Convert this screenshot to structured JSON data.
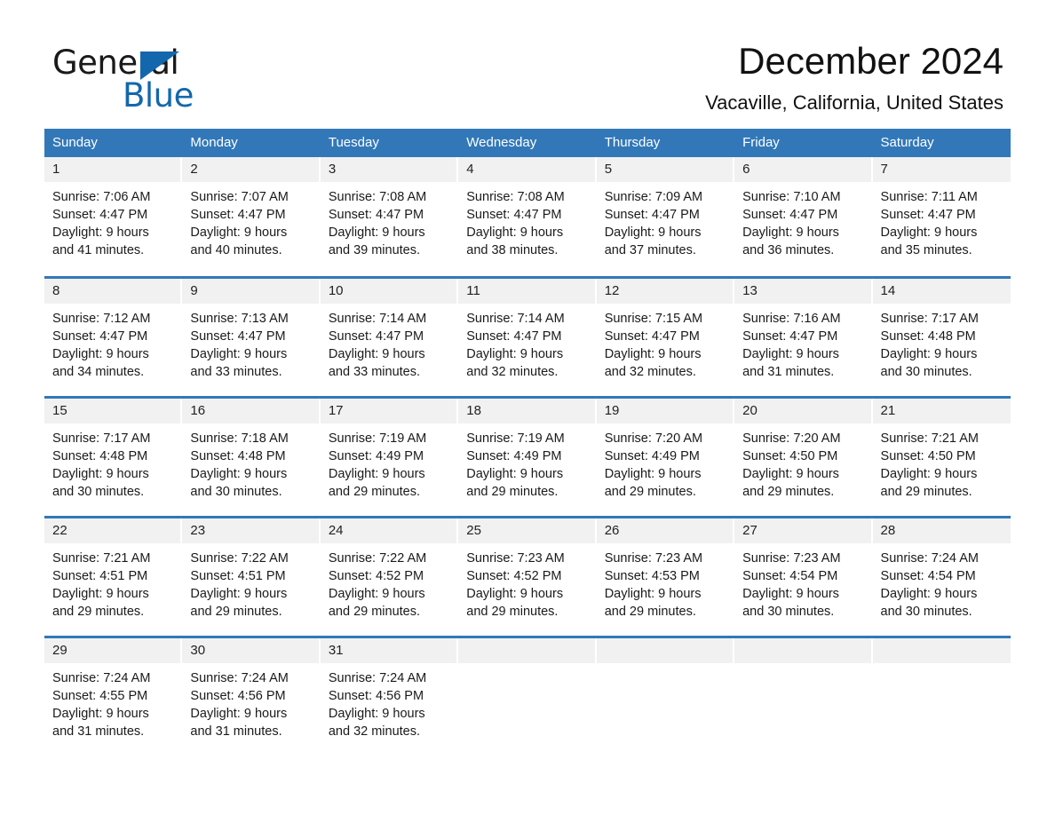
{
  "brand": {
    "name_top": "General",
    "name_bottom": "Blue",
    "triangle_color": "#1368ad",
    "text_color": "#1a1a1a"
  },
  "header": {
    "month_title": "December 2024",
    "location": "Vacaville, California, United States",
    "header_bg": "#3278b8",
    "header_text": "#ffffff",
    "daynum_bg": "#f1f1f1"
  },
  "weekday_headers": [
    "Sunday",
    "Monday",
    "Tuesday",
    "Wednesday",
    "Thursday",
    "Friday",
    "Saturday"
  ],
  "weeks": [
    [
      {
        "day": "1",
        "sunrise": "Sunrise: 7:06 AM",
        "sunset": "Sunset: 4:47 PM",
        "daylight_line1": "Daylight: 9 hours",
        "daylight_line2": "and 41 minutes."
      },
      {
        "day": "2",
        "sunrise": "Sunrise: 7:07 AM",
        "sunset": "Sunset: 4:47 PM",
        "daylight_line1": "Daylight: 9 hours",
        "daylight_line2": "and 40 minutes."
      },
      {
        "day": "3",
        "sunrise": "Sunrise: 7:08 AM",
        "sunset": "Sunset: 4:47 PM",
        "daylight_line1": "Daylight: 9 hours",
        "daylight_line2": "and 39 minutes."
      },
      {
        "day": "4",
        "sunrise": "Sunrise: 7:08 AM",
        "sunset": "Sunset: 4:47 PM",
        "daylight_line1": "Daylight: 9 hours",
        "daylight_line2": "and 38 minutes."
      },
      {
        "day": "5",
        "sunrise": "Sunrise: 7:09 AM",
        "sunset": "Sunset: 4:47 PM",
        "daylight_line1": "Daylight: 9 hours",
        "daylight_line2": "and 37 minutes."
      },
      {
        "day": "6",
        "sunrise": "Sunrise: 7:10 AM",
        "sunset": "Sunset: 4:47 PM",
        "daylight_line1": "Daylight: 9 hours",
        "daylight_line2": "and 36 minutes."
      },
      {
        "day": "7",
        "sunrise": "Sunrise: 7:11 AM",
        "sunset": "Sunset: 4:47 PM",
        "daylight_line1": "Daylight: 9 hours",
        "daylight_line2": "and 35 minutes."
      }
    ],
    [
      {
        "day": "8",
        "sunrise": "Sunrise: 7:12 AM",
        "sunset": "Sunset: 4:47 PM",
        "daylight_line1": "Daylight: 9 hours",
        "daylight_line2": "and 34 minutes."
      },
      {
        "day": "9",
        "sunrise": "Sunrise: 7:13 AM",
        "sunset": "Sunset: 4:47 PM",
        "daylight_line1": "Daylight: 9 hours",
        "daylight_line2": "and 33 minutes."
      },
      {
        "day": "10",
        "sunrise": "Sunrise: 7:14 AM",
        "sunset": "Sunset: 4:47 PM",
        "daylight_line1": "Daylight: 9 hours",
        "daylight_line2": "and 33 minutes."
      },
      {
        "day": "11",
        "sunrise": "Sunrise: 7:14 AM",
        "sunset": "Sunset: 4:47 PM",
        "daylight_line1": "Daylight: 9 hours",
        "daylight_line2": "and 32 minutes."
      },
      {
        "day": "12",
        "sunrise": "Sunrise: 7:15 AM",
        "sunset": "Sunset: 4:47 PM",
        "daylight_line1": "Daylight: 9 hours",
        "daylight_line2": "and 32 minutes."
      },
      {
        "day": "13",
        "sunrise": "Sunrise: 7:16 AM",
        "sunset": "Sunset: 4:47 PM",
        "daylight_line1": "Daylight: 9 hours",
        "daylight_line2": "and 31 minutes."
      },
      {
        "day": "14",
        "sunrise": "Sunrise: 7:17 AM",
        "sunset": "Sunset: 4:48 PM",
        "daylight_line1": "Daylight: 9 hours",
        "daylight_line2": "and 30 minutes."
      }
    ],
    [
      {
        "day": "15",
        "sunrise": "Sunrise: 7:17 AM",
        "sunset": "Sunset: 4:48 PM",
        "daylight_line1": "Daylight: 9 hours",
        "daylight_line2": "and 30 minutes."
      },
      {
        "day": "16",
        "sunrise": "Sunrise: 7:18 AM",
        "sunset": "Sunset: 4:48 PM",
        "daylight_line1": "Daylight: 9 hours",
        "daylight_line2": "and 30 minutes."
      },
      {
        "day": "17",
        "sunrise": "Sunrise: 7:19 AM",
        "sunset": "Sunset: 4:49 PM",
        "daylight_line1": "Daylight: 9 hours",
        "daylight_line2": "and 29 minutes."
      },
      {
        "day": "18",
        "sunrise": "Sunrise: 7:19 AM",
        "sunset": "Sunset: 4:49 PM",
        "daylight_line1": "Daylight: 9 hours",
        "daylight_line2": "and 29 minutes."
      },
      {
        "day": "19",
        "sunrise": "Sunrise: 7:20 AM",
        "sunset": "Sunset: 4:49 PM",
        "daylight_line1": "Daylight: 9 hours",
        "daylight_line2": "and 29 minutes."
      },
      {
        "day": "20",
        "sunrise": "Sunrise: 7:20 AM",
        "sunset": "Sunset: 4:50 PM",
        "daylight_line1": "Daylight: 9 hours",
        "daylight_line2": "and 29 minutes."
      },
      {
        "day": "21",
        "sunrise": "Sunrise: 7:21 AM",
        "sunset": "Sunset: 4:50 PM",
        "daylight_line1": "Daylight: 9 hours",
        "daylight_line2": "and 29 minutes."
      }
    ],
    [
      {
        "day": "22",
        "sunrise": "Sunrise: 7:21 AM",
        "sunset": "Sunset: 4:51 PM",
        "daylight_line1": "Daylight: 9 hours",
        "daylight_line2": "and 29 minutes."
      },
      {
        "day": "23",
        "sunrise": "Sunrise: 7:22 AM",
        "sunset": "Sunset: 4:51 PM",
        "daylight_line1": "Daylight: 9 hours",
        "daylight_line2": "and 29 minutes."
      },
      {
        "day": "24",
        "sunrise": "Sunrise: 7:22 AM",
        "sunset": "Sunset: 4:52 PM",
        "daylight_line1": "Daylight: 9 hours",
        "daylight_line2": "and 29 minutes."
      },
      {
        "day": "25",
        "sunrise": "Sunrise: 7:23 AM",
        "sunset": "Sunset: 4:52 PM",
        "daylight_line1": "Daylight: 9 hours",
        "daylight_line2": "and 29 minutes."
      },
      {
        "day": "26",
        "sunrise": "Sunrise: 7:23 AM",
        "sunset": "Sunset: 4:53 PM",
        "daylight_line1": "Daylight: 9 hours",
        "daylight_line2": "and 29 minutes."
      },
      {
        "day": "27",
        "sunrise": "Sunrise: 7:23 AM",
        "sunset": "Sunset: 4:54 PM",
        "daylight_line1": "Daylight: 9 hours",
        "daylight_line2": "and 30 minutes."
      },
      {
        "day": "28",
        "sunrise": "Sunrise: 7:24 AM",
        "sunset": "Sunset: 4:54 PM",
        "daylight_line1": "Daylight: 9 hours",
        "daylight_line2": "and 30 minutes."
      }
    ],
    [
      {
        "day": "29",
        "sunrise": "Sunrise: 7:24 AM",
        "sunset": "Sunset: 4:55 PM",
        "daylight_line1": "Daylight: 9 hours",
        "daylight_line2": "and 31 minutes."
      },
      {
        "day": "30",
        "sunrise": "Sunrise: 7:24 AM",
        "sunset": "Sunset: 4:56 PM",
        "daylight_line1": "Daylight: 9 hours",
        "daylight_line2": "and 31 minutes."
      },
      {
        "day": "31",
        "sunrise": "Sunrise: 7:24 AM",
        "sunset": "Sunset: 4:56 PM",
        "daylight_line1": "Daylight: 9 hours",
        "daylight_line2": "and 32 minutes."
      },
      {
        "day": "",
        "sunrise": "",
        "sunset": "",
        "daylight_line1": "",
        "daylight_line2": "",
        "empty": true
      },
      {
        "day": "",
        "sunrise": "",
        "sunset": "",
        "daylight_line1": "",
        "daylight_line2": "",
        "empty": true
      },
      {
        "day": "",
        "sunrise": "",
        "sunset": "",
        "daylight_line1": "",
        "daylight_line2": "",
        "empty": true
      },
      {
        "day": "",
        "sunrise": "",
        "sunset": "",
        "daylight_line1": "",
        "daylight_line2": "",
        "empty": true
      }
    ]
  ]
}
